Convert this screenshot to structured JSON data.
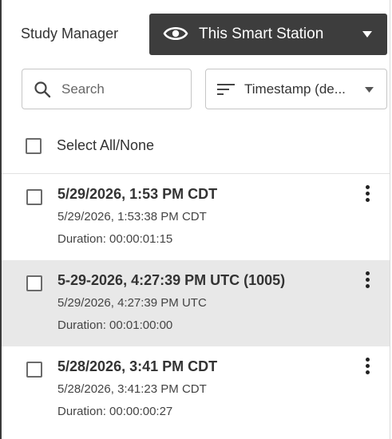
{
  "header": {
    "title": "Study Manager",
    "station_button": {
      "label": "This Smart Station",
      "icon": "eye-icon"
    }
  },
  "search": {
    "placeholder": "Search",
    "value": ""
  },
  "sort": {
    "label": "Timestamp (de..."
  },
  "select_all": {
    "label": "Select All/None",
    "checked": false
  },
  "studies": [
    {
      "title": "5/29/2026, 1:53 PM CDT",
      "timestamp": "5/29/2026, 1:53:38 PM CDT",
      "duration": "Duration: 00:00:01:15",
      "checked": false,
      "highlighted": false
    },
    {
      "title": "5-29-2026, 4:27:39 PM UTC (1005)",
      "timestamp": "5/29/2026, 4:27:39 PM UTC",
      "duration": "Duration: 00:01:00:00",
      "checked": false,
      "highlighted": true
    },
    {
      "title": "5/28/2026, 3:41 PM CDT",
      "timestamp": "5/28/2026, 3:41:23 PM CDT",
      "duration": "Duration: 00:00:00:27",
      "checked": false,
      "highlighted": false
    }
  ]
}
